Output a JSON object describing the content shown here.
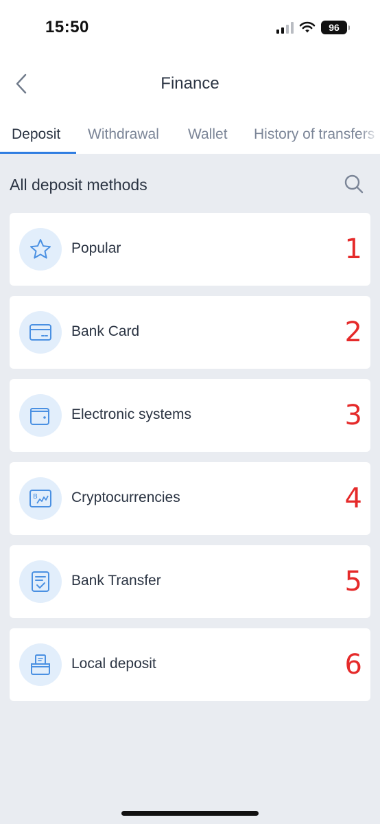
{
  "status": {
    "time": "15:50",
    "battery": "96"
  },
  "header": {
    "title": "Finance"
  },
  "tabs": [
    {
      "label": "Deposit"
    },
    {
      "label": "Withdrawal"
    },
    {
      "label": "Wallet"
    },
    {
      "label": "History of transfers"
    }
  ],
  "section": {
    "title": "All deposit methods"
  },
  "methods": [
    {
      "label": "Popular",
      "number": "1",
      "icon": "star-icon"
    },
    {
      "label": "Bank Card",
      "number": "2",
      "icon": "bank-card-icon"
    },
    {
      "label": "Electronic systems",
      "number": "3",
      "icon": "wallet-icon"
    },
    {
      "label": "Cryptocurrencies",
      "number": "4",
      "icon": "crypto-icon"
    },
    {
      "label": "Bank Transfer",
      "number": "5",
      "icon": "bank-transfer-icon"
    },
    {
      "label": "Local deposit",
      "number": "6",
      "icon": "local-deposit-icon"
    }
  ],
  "colors": {
    "accent": "#2f7de1",
    "icon": "#4a90e2",
    "icon_bg": "#e2eefb",
    "number": "#e52a2a",
    "background": "#e9ecf1"
  }
}
